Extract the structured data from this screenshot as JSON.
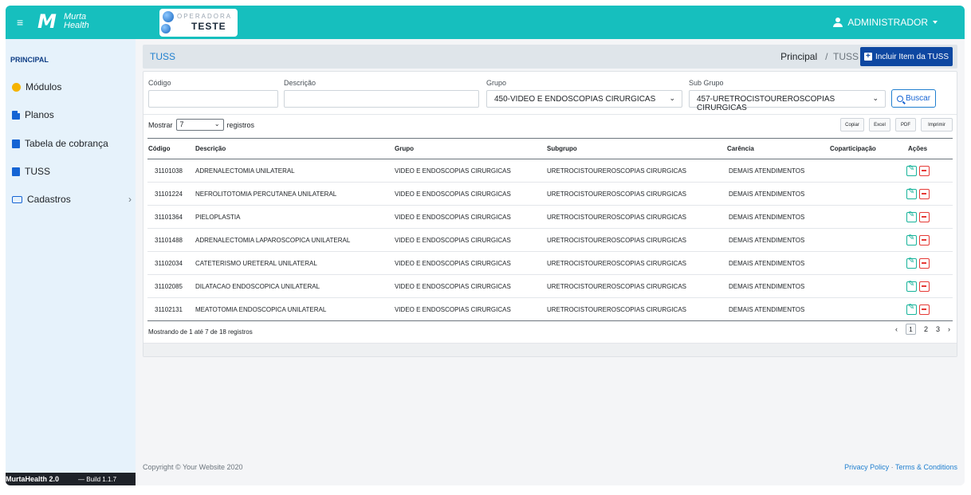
{
  "topbar": {
    "logo_mark": "M",
    "logo_line1": "Murta",
    "logo_line2": "Health",
    "operadora_top": "OPERADORA",
    "operadora_bottom": "TESTE",
    "user_label": "ADMINISTRADOR"
  },
  "sidebar": {
    "heading": "PRINCIPAL",
    "items": [
      {
        "label": "Módulos",
        "icon": "puzzle-icon"
      },
      {
        "label": "Planos",
        "icon": "document-icon"
      },
      {
        "label": "Tabela de cobrança",
        "icon": "book-icon"
      },
      {
        "label": "TUSS",
        "icon": "book-icon"
      },
      {
        "label": "Cadastros",
        "icon": "keyboard-icon"
      }
    ],
    "footer_version": "MurtaHealth 2.0",
    "footer_build": "— Build 1.1.7"
  },
  "breadcrumb": {
    "title": "TUSS",
    "home": "Principal",
    "separator": "/",
    "current": "TUSS",
    "add_button": "Incluir Item da TUSS"
  },
  "filters": {
    "codigo_label": "Código",
    "codigo_value": "",
    "descricao_label": "Descrição",
    "descricao_value": "",
    "grupo_label": "Grupo",
    "grupo_value": "450-VIDEO E ENDOSCOPIAS CIRURGICAS",
    "subgrupo_label": "Sub Grupo",
    "subgrupo_value": "457-URETROCISTOUREROSCOPIAS CIRURGICAS",
    "search_button": "Buscar"
  },
  "table_controls": {
    "show_label": "Mostrar",
    "page_length": "7",
    "records_label": "registros",
    "export_buttons": [
      "Copiar",
      "Excel",
      "PDF",
      "Imprimir"
    ]
  },
  "table": {
    "columns": [
      "Código",
      "Descrição",
      "Grupo",
      "Subgrupo",
      "Carência",
      "Coparticipação",
      "Ações"
    ],
    "rows": [
      [
        "31101038",
        "ADRENALECTOMIA UNILATERAL",
        "VIDEO E ENDOSCOPIAS CIRURGICAS",
        "URETROCISTOUREROSCOPIAS CIRURGICAS",
        "DEMAIS ATENDIMENTOS",
        ""
      ],
      [
        "31101224",
        "NEFROLITOTOMIA PERCUTANEA UNILATERAL",
        "VIDEO E ENDOSCOPIAS CIRURGICAS",
        "URETROCISTOUREROSCOPIAS CIRURGICAS",
        "DEMAIS ATENDIMENTOS",
        ""
      ],
      [
        "31101364",
        "PIELOPLASTIA",
        "VIDEO E ENDOSCOPIAS CIRURGICAS",
        "URETROCISTOUREROSCOPIAS CIRURGICAS",
        "DEMAIS ATENDIMENTOS",
        ""
      ],
      [
        "31101488",
        "ADRENALECTOMIA LAPAROSCOPICA UNILATERAL",
        "VIDEO E ENDOSCOPIAS CIRURGICAS",
        "URETROCISTOUREROSCOPIAS CIRURGICAS",
        "DEMAIS ATENDIMENTOS",
        ""
      ],
      [
        "31102034",
        "CATETERISMO URETERAL UNILATERAL",
        "VIDEO E ENDOSCOPIAS CIRURGICAS",
        "URETROCISTOUREROSCOPIAS CIRURGICAS",
        "DEMAIS ATENDIMENTOS",
        ""
      ],
      [
        "31102085",
        "DILATACAO ENDOSCOPICA UNILATERAL",
        "VIDEO E ENDOSCOPIAS CIRURGICAS",
        "URETROCISTOUREROSCOPIAS CIRURGICAS",
        "DEMAIS ATENDIMENTOS",
        ""
      ],
      [
        "31102131",
        "MEATOTOMIA ENDOSCOPICA UNILATERAL",
        "VIDEO E ENDOSCOPIAS CIRURGICAS",
        "URETROCISTOUREROSCOPIAS CIRURGICAS",
        "DEMAIS ATENDIMENTOS",
        ""
      ]
    ]
  },
  "pagination": {
    "info": "Mostrando de 1 até 7 de 18 registros",
    "prev": "‹",
    "pages": [
      "1",
      "2",
      "3"
    ],
    "current_page": "1",
    "next": "›"
  },
  "footer": {
    "copyright": "Copyright © Your Website 2020",
    "privacy": "Privacy Policy",
    "separator": "·",
    "terms": "Terms & Conditions"
  },
  "colors": {
    "topbar": "#16bfbe",
    "primary_button": "#0d47a1",
    "edit_action": "#17b39a",
    "delete_action": "#e53935",
    "sidebar_bg": "#e6f2fb"
  }
}
